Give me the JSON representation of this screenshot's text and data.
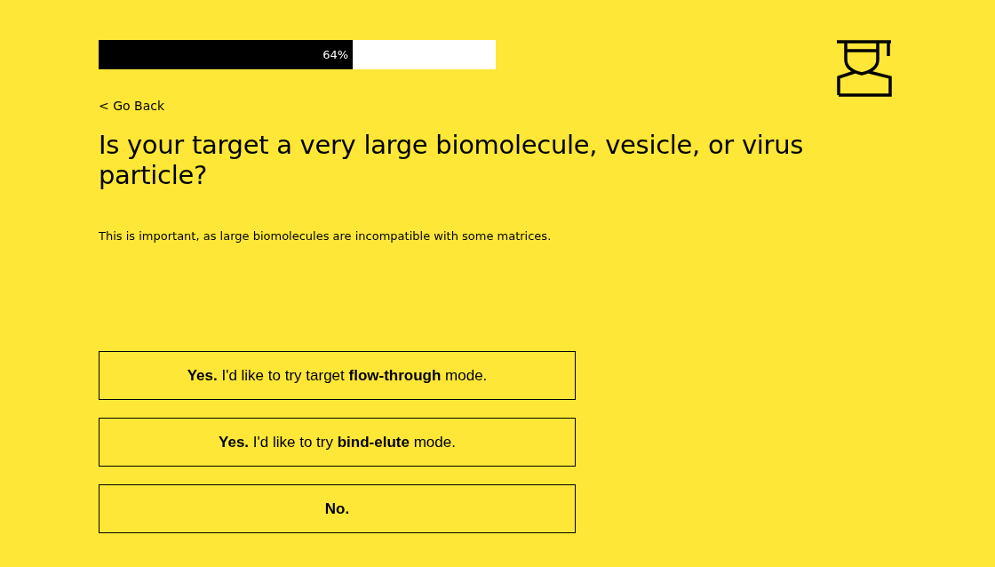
{
  "progress": {
    "level": 0.64,
    "reading": "64%"
  },
  "back_link": "< Go Back",
  "question": "Is your target a very large biomolecule, vesicle, or virus particle?",
  "note": "This is important, as large biomolecules are incompatible with some matrices.",
  "answers": [
    {
      "label": "**Yes.** I'd like to try target **flow-through** mode."
    },
    {
      "label": "**Yes.** I'd like to try **bind-elute** mode."
    },
    {
      "label": "**No.**"
    }
  ]
}
